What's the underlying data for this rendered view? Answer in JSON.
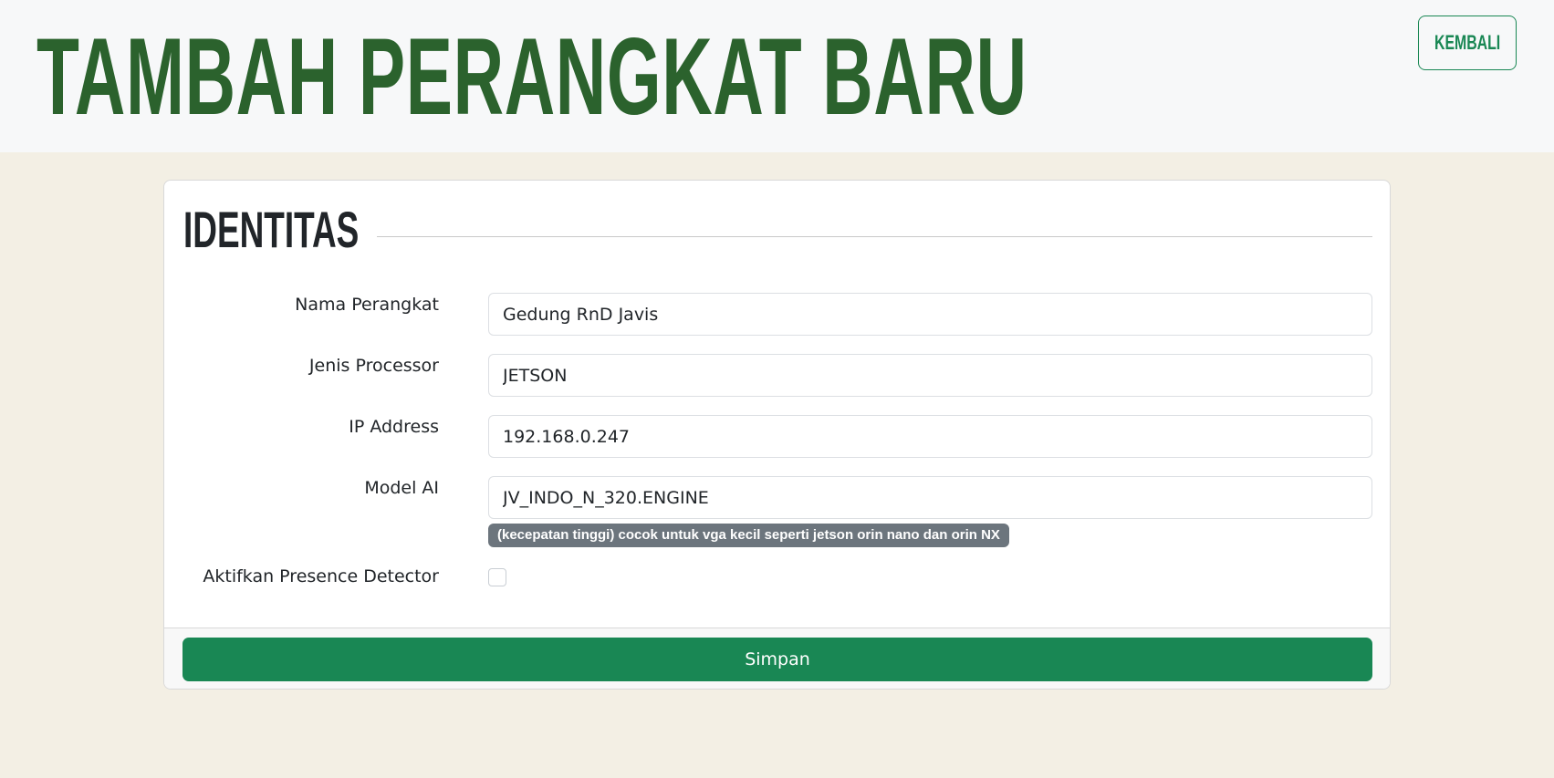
{
  "header": {
    "title": "TAMBAH PERANGKAT BARU",
    "back_label": "KEMBALI"
  },
  "card": {
    "section_title": "IDENTITAS",
    "fields": [
      {
        "label": "Nama Perangkat",
        "value": "Gedung RnD Javis"
      },
      {
        "label": "Jenis Processor",
        "value": "JETSON"
      },
      {
        "label": "IP Address",
        "value": "192.168.0.247"
      },
      {
        "label": "Model AI",
        "value": "JV_INDO_N_320.ENGINE"
      }
    ],
    "model_hint": "(kecepatan tinggi) cocok untuk vga kecil seperti jetson orin nano dan orin NX",
    "presence_label": "Aktifkan Presence Detector",
    "presence_checked": false,
    "save_label": "Simpan"
  },
  "colors": {
    "title_green": "#2b622d",
    "accent_green": "#198754",
    "page_background": "#f3efe4",
    "badge_gray": "#6c757d"
  }
}
